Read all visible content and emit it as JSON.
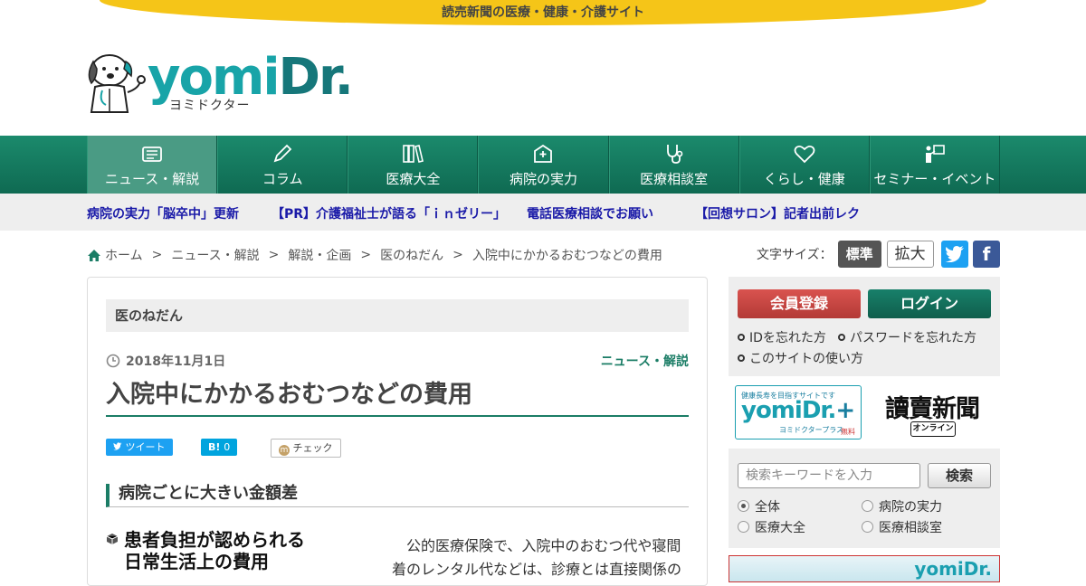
{
  "tagline": "読売新聞の医療・健康・介護サイト",
  "logo": {
    "word_main": "yomi",
    "word_accent": "Dr.",
    "sub": "ヨミドクター"
  },
  "nav": [
    {
      "label": "ニュース・解説",
      "icon": "news-icon"
    },
    {
      "label": "コラム",
      "icon": "pen-icon"
    },
    {
      "label": "医療大全",
      "icon": "books-icon"
    },
    {
      "label": "病院の実力",
      "icon": "hospital-icon"
    },
    {
      "label": "医療相談室",
      "icon": "stethoscope-icon"
    },
    {
      "label": "くらし・健康",
      "icon": "heart-icon"
    },
    {
      "label": "セミナー・イベント",
      "icon": "presenter-icon"
    }
  ],
  "ticker": [
    "病院の実力「脳卒中」更新",
    "【PR】介護福祉士が語る「ｉｎゼリー」",
    "電話医療相談でお願い",
    "【回想サロン】記者出前レク"
  ],
  "breadcrumb": [
    "ホーム",
    "ニュース・解説",
    "解説・企画",
    "医のねだん",
    "入院中にかかるおむつなどの費用"
  ],
  "breadcrumb_sep": ">",
  "fontsize": {
    "label": "文字サイズ：",
    "normal": "標準",
    "large": "拡大"
  },
  "social": {
    "twitter": "t",
    "facebook": "f"
  },
  "article": {
    "category": "医のねだん",
    "date": "2018年11月1日",
    "section": "ニュース・解説",
    "title": "入院中にかかるおむつなどの費用",
    "share": {
      "tweet": "ツイート",
      "hatena": "B!",
      "hatena_count": "0",
      "check": "チェック"
    },
    "subhead": "病院ごとに大きい金額差",
    "figure_title_line1": "患者負担が認められる",
    "figure_title_line2": "日常生活上の費用",
    "body": "公的医療保険で、入院中のおむつ代や寝間着のレンタル代などは、診療とは直接関係の"
  },
  "sidebar": {
    "register": "会員登録",
    "login": "ログイン",
    "forgot_id": "IDを忘れた方",
    "forgot_password": "パスワードを忘れた方",
    "how_to_use": "このサイトの使い方",
    "plus_banner": {
      "top": "健康長寿を目指すサイトです",
      "main": "yomiDr.",
      "plus": "+",
      "sub": "ヨミドクタープラス",
      "free": "無料"
    },
    "yomiuri_banner": {
      "name": "讀賣新聞",
      "badge": "オンライン"
    },
    "search": {
      "placeholder": "検索キーワードを入力",
      "button": "検索",
      "options": [
        "全体",
        "病院の実力",
        "医療大全",
        "医療相談室"
      ],
      "selected": "全体"
    }
  },
  "colors": {
    "brand_green": "#1b7d66",
    "tagline_yellow": "#f5c518",
    "logo_teal": "#18a4a8",
    "register_red": "#d9534f"
  }
}
